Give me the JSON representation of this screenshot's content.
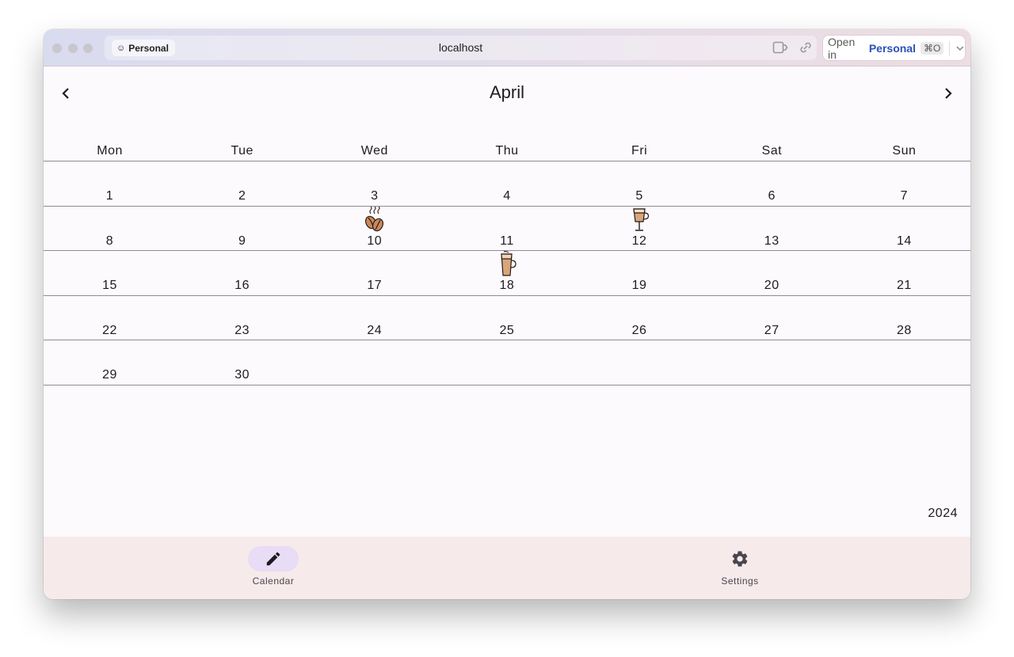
{
  "browser": {
    "profile_label": "Personal",
    "url": "localhost",
    "open_in_prefix": "Open in",
    "open_in_brand": "Personal",
    "shortcut": "⌘O"
  },
  "calendar": {
    "month": "April",
    "year": "2024",
    "weekdays": [
      "Mon",
      "Tue",
      "Wed",
      "Thu",
      "Fri",
      "Sat",
      "Sun"
    ],
    "weeks": [
      [
        "1",
        "2",
        "3",
        "4",
        "5",
        "6",
        "7"
      ],
      [
        "8",
        "9",
        "10",
        "11",
        "12",
        "13",
        "14"
      ],
      [
        "15",
        "16",
        "17",
        "18",
        "19",
        "20",
        "21"
      ],
      [
        "22",
        "23",
        "24",
        "25",
        "26",
        "27",
        "28"
      ],
      [
        "29",
        "30",
        "",
        "",
        "",
        "",
        ""
      ]
    ],
    "entries": [
      {
        "day": "10",
        "icon": "coffee-beans-icon"
      },
      {
        "day": "12",
        "icon": "latte-glass-icon"
      },
      {
        "day": "18",
        "icon": "iced-coffee-icon"
      }
    ]
  },
  "bottom_nav": {
    "items": [
      {
        "label": "Calendar",
        "icon": "pencil-icon",
        "selected": true
      },
      {
        "label": "Settings",
        "icon": "gear-icon",
        "selected": false
      }
    ]
  },
  "colors": {
    "background": "#fdfafd",
    "nav_background": "#f7eaea",
    "selected_pill": "#e8dcf6",
    "brand": "#2b52b8"
  }
}
